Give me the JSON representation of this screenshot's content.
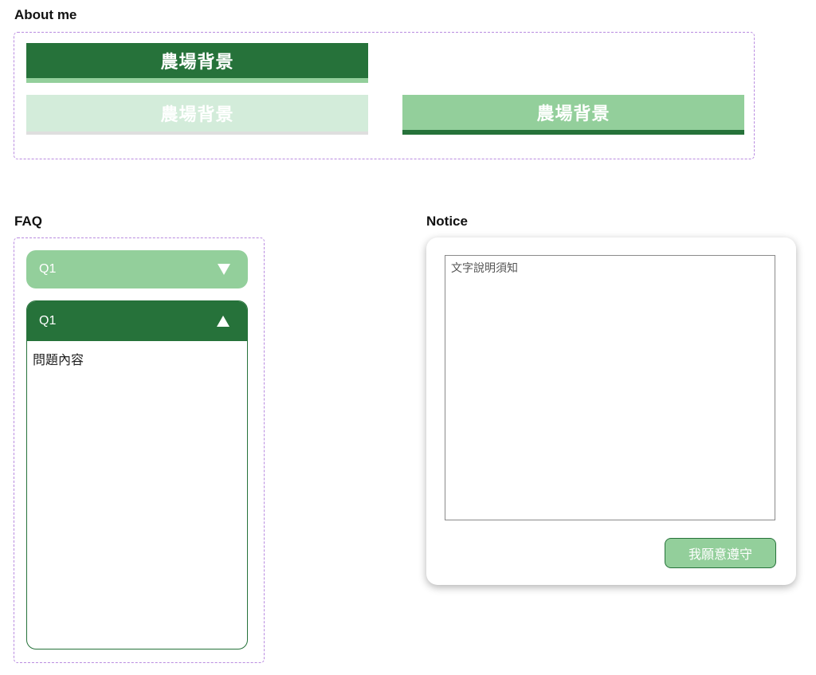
{
  "about": {
    "title": "About me",
    "tabs": [
      {
        "label": "農場背景",
        "state": "active"
      },
      {
        "label": "農場背景",
        "state": "disabled"
      },
      {
        "label": "農場背景",
        "state": "hover"
      }
    ]
  },
  "faq": {
    "title": "FAQ",
    "items": [
      {
        "question": "Q1",
        "expanded": false
      },
      {
        "question": "Q1",
        "expanded": true,
        "answer": "問題內容"
      }
    ]
  },
  "notice": {
    "title": "Notice",
    "textarea_placeholder": "文字說明須知",
    "agree_label": "我願意遵守"
  },
  "colors": {
    "dark_green": "#26723a",
    "light_green": "#93cf9b",
    "pale_green": "#d3ecda",
    "frame_purple": "#b98be0"
  }
}
